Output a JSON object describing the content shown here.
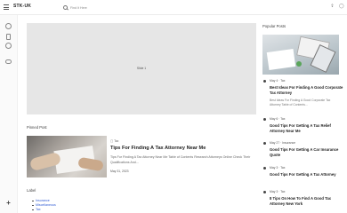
{
  "header": {
    "brand": "STK-UK",
    "search_placeholder": "Find It Here",
    "icons": [
      "menu-icon",
      "search-icon",
      "share-icon",
      "user-icon"
    ]
  },
  "rail": {
    "icons": [
      "circle-icon",
      "document-icon",
      "clock-icon",
      "cloud-icon",
      "plus-icon"
    ]
  },
  "slider": {
    "label": "Slide 1"
  },
  "pinned": {
    "section_title": "Pinned Post",
    "category": "Tax",
    "title": "Tips For Finding A Tax Attorney Near Me",
    "excerpt": "Tips For Finding A Tax Attorney Near Me Table of Contents Research Attorneys Online Check Their Qualifications And...",
    "date": "May 31, 2023"
  },
  "labels": {
    "section_title": "Label",
    "items": [
      "Insurance",
      "Miscellaneous",
      "Tax"
    ]
  },
  "popular": {
    "section_title": "Popular Posts",
    "posts": [
      {
        "date": "May 4",
        "category": "Tax",
        "title": "Best Ideas For Finding A Good Corporate Tax Attorney",
        "excerpt": "Best Ideas For Finding A Good Corporate Tax Attorney Table of Contents..."
      },
      {
        "date": "May 6",
        "category": "Tax",
        "title": "Good Tips For Getting A Tax Relief Attorney Near Me",
        "excerpt": ""
      },
      {
        "date": "May 27",
        "category": "Insurance",
        "title": "Good Tips For Getting A Car Insurance Quote",
        "excerpt": ""
      },
      {
        "date": "May 3",
        "category": "Tax",
        "title": "Good Tips For Getting A Tax Attorney",
        "excerpt": ""
      },
      {
        "date": "May 3",
        "category": "Tax",
        "title": "8 Tips On How To Find A Good Tax Attorney New York",
        "excerpt": ""
      }
    ]
  }
}
